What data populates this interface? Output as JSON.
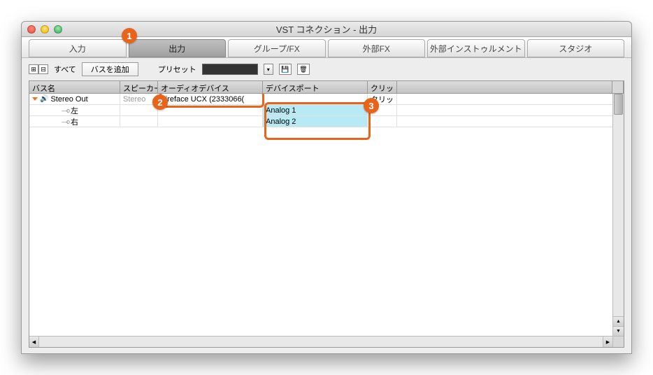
{
  "window": {
    "title": "VST コネクション - 出力"
  },
  "tabs": [
    {
      "label": "入力",
      "active": false
    },
    {
      "label": "出力",
      "active": true
    },
    {
      "label": "グループ/FX",
      "active": false
    },
    {
      "label": "外部FX",
      "active": false
    },
    {
      "label": "外部インストゥルメント",
      "active": false
    },
    {
      "label": "スタジオ",
      "active": false
    }
  ],
  "toolbar": {
    "all_label": "すべて",
    "add_bus_label": "バスを追加",
    "preset_label": "プリセット"
  },
  "columns": {
    "bus": "バス名",
    "speaker": "スピーカー",
    "device": "オーディオデバイス",
    "port": "デバイスポート",
    "click": "クリッ"
  },
  "rows": {
    "main": {
      "bus": "Stereo Out",
      "speaker": "Stereo",
      "device": "Fireface UCX (2333066(",
      "port": "",
      "click": "クリッ"
    },
    "left": {
      "bus": "左",
      "port": "Analog 1"
    },
    "right": {
      "bus": "右",
      "port": "Analog 2"
    }
  },
  "callouts": {
    "c1": "1",
    "c2": "2",
    "c3": "3"
  }
}
